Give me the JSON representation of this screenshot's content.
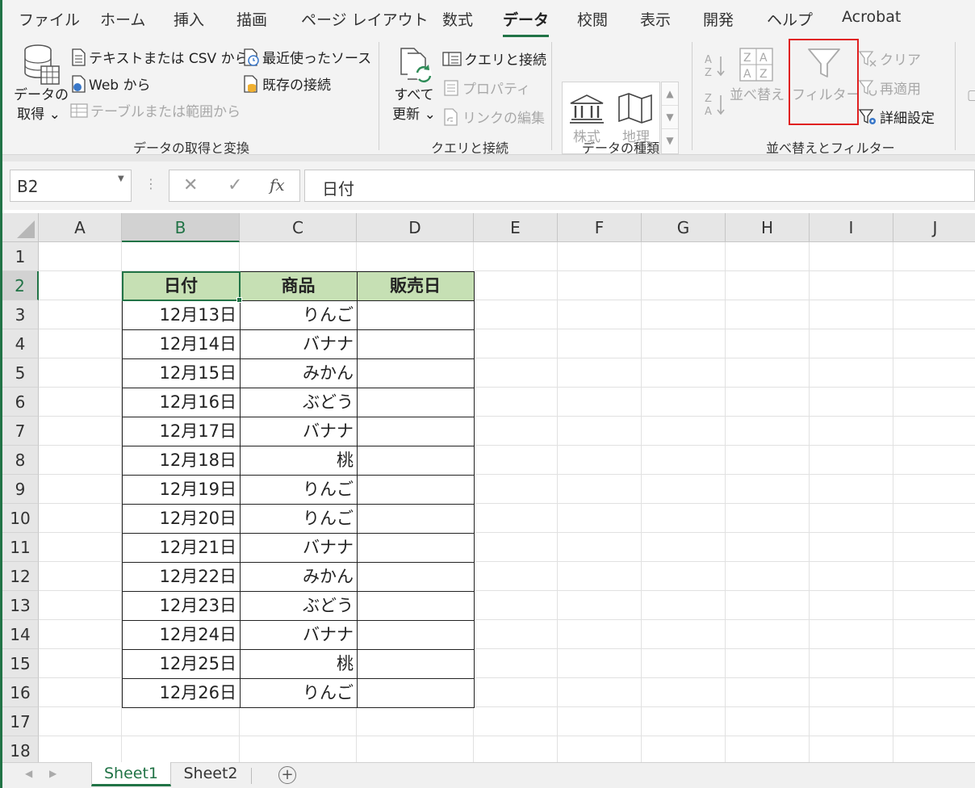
{
  "menu_tabs": [
    "ファイル",
    "ホーム",
    "挿入",
    "描画",
    "ページ レイアウト",
    "数式",
    "データ",
    "校閲",
    "表示",
    "開発",
    "ヘルプ",
    "Acrobat"
  ],
  "ribbon": {
    "get_data": {
      "big_label_1": "データの",
      "big_label_2": "取得 ⌄",
      "text_csv": "テキストまたは CSV から",
      "web": "Web から",
      "table_range": "テーブルまたは範囲から",
      "recent_sources": "最近使ったソース",
      "existing_connections": "既存の接続",
      "group_label": "データの取得と変換"
    },
    "queries": {
      "refresh_1": "すべて",
      "refresh_2": "更新 ⌄",
      "queries_connections": "クエリと接続",
      "properties": "プロパティ",
      "edit_links": "リンクの編集",
      "group_label": "クエリと接続"
    },
    "data_types": {
      "stocks": "株式",
      "geography": "地理",
      "group_label": "データの種類"
    },
    "sort_filter": {
      "sort": "並べ替え",
      "filter": "フィルター",
      "clear": "クリア",
      "reapply": "再適用",
      "advanced": "詳細設定",
      "group_label": "並べ替えとフィルター"
    }
  },
  "formula_bar": {
    "name_box": "B2",
    "formula": "日付"
  },
  "columns": [
    "A",
    "B",
    "C",
    "D",
    "E",
    "F",
    "G",
    "H",
    "I",
    "J"
  ],
  "rows": [
    "1",
    "2",
    "3",
    "4",
    "5",
    "6",
    "7",
    "8",
    "9",
    "10",
    "11",
    "12",
    "13",
    "14",
    "15",
    "16",
    "17",
    "18"
  ],
  "table": {
    "headers": [
      "日付",
      "商品",
      "販売日"
    ],
    "rows": [
      [
        "12月13日",
        "りんご",
        ""
      ],
      [
        "12月14日",
        "バナナ",
        ""
      ],
      [
        "12月15日",
        "みかん",
        ""
      ],
      [
        "12月16日",
        "ぶどう",
        ""
      ],
      [
        "12月17日",
        "バナナ",
        ""
      ],
      [
        "12月18日",
        "桃",
        ""
      ],
      [
        "12月19日",
        "りんご",
        ""
      ],
      [
        "12月20日",
        "りんご",
        ""
      ],
      [
        "12月21日",
        "バナナ",
        ""
      ],
      [
        "12月22日",
        "みかん",
        ""
      ],
      [
        "12月23日",
        "ぶどう",
        ""
      ],
      [
        "12月24日",
        "バナナ",
        ""
      ],
      [
        "12月25日",
        "桃",
        ""
      ],
      [
        "12月26日",
        "りんご",
        ""
      ]
    ]
  },
  "sheets": [
    "Sheet1",
    "Sheet2"
  ],
  "colors": {
    "accent": "#217346",
    "header_fill": "#c6e0b4",
    "highlight": "#e02020"
  }
}
